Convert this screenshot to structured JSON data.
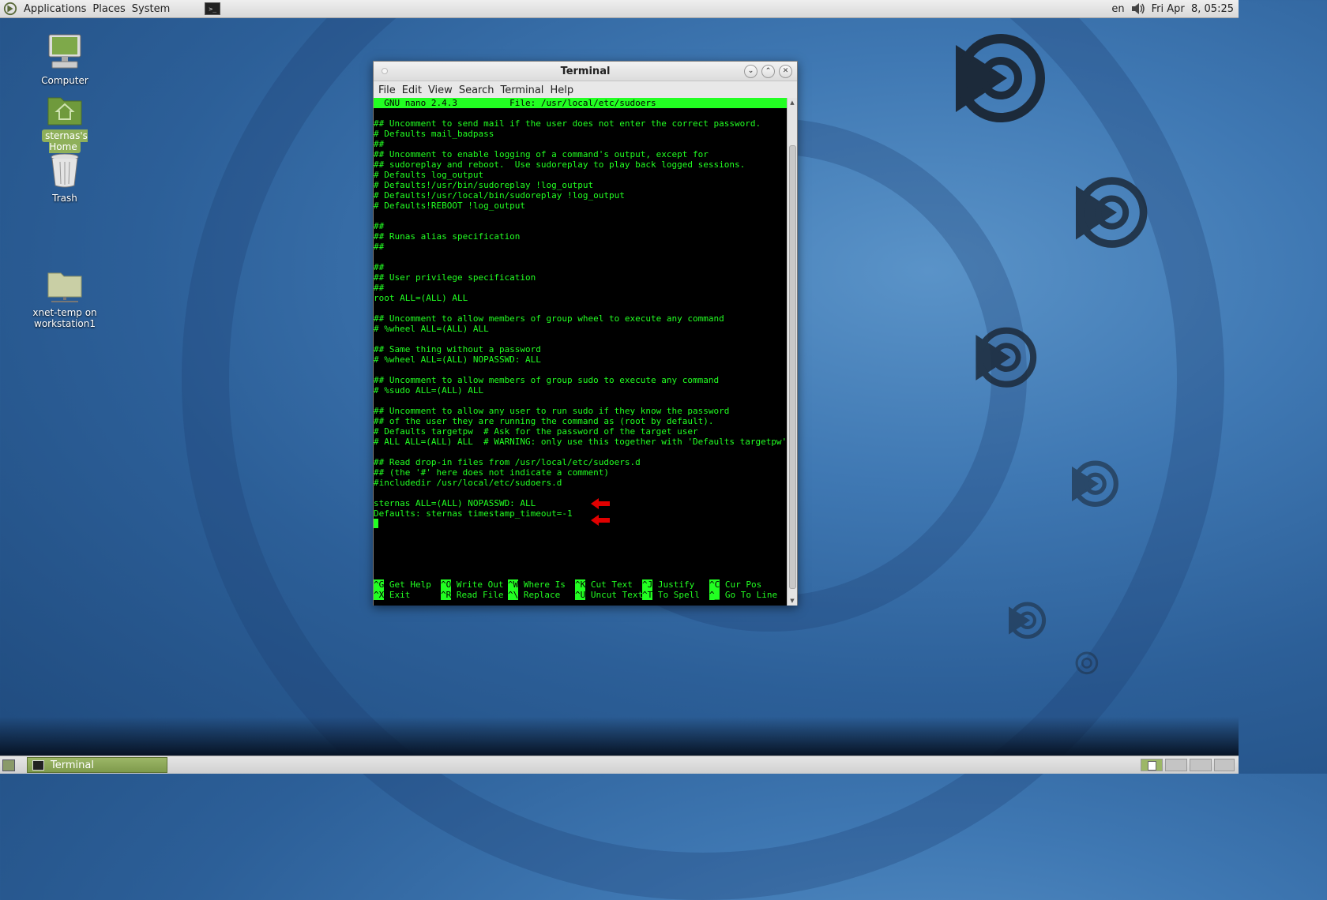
{
  "top_panel": {
    "menus": [
      "Applications",
      "Places",
      "System"
    ],
    "keyboard_layout": "en",
    "clock": "Fri Apr  8, 05:25"
  },
  "desktop_icons": [
    {
      "label": "Computer",
      "icon": "computer-icon"
    },
    {
      "label": "sternas's Home",
      "icon": "home-folder-icon",
      "selected": true
    },
    {
      "label": "Trash",
      "icon": "trash-icon"
    },
    {
      "label": "xnet-temp on\nworkstation1",
      "icon": "network-folder-icon"
    }
  ],
  "window": {
    "title": "Terminal",
    "menus": [
      "File",
      "Edit",
      "View",
      "Search",
      "Terminal",
      "Help"
    ]
  },
  "nano": {
    "header": "  GNU nano 2.4.3          File: /usr/local/etc/sudoers",
    "lines": [
      "",
      "## Uncomment to send mail if the user does not enter the correct password.",
      "# Defaults mail_badpass",
      "##",
      "## Uncomment to enable logging of a command's output, except for",
      "## sudoreplay and reboot.  Use sudoreplay to play back logged sessions.",
      "# Defaults log_output",
      "# Defaults!/usr/bin/sudoreplay !log_output",
      "# Defaults!/usr/local/bin/sudoreplay !log_output",
      "# Defaults!REBOOT !log_output",
      "",
      "##",
      "## Runas alias specification",
      "##",
      "",
      "##",
      "## User privilege specification",
      "##",
      "root ALL=(ALL) ALL",
      "",
      "## Uncomment to allow members of group wheel to execute any command",
      "# %wheel ALL=(ALL) ALL",
      "",
      "## Same thing without a password",
      "# %wheel ALL=(ALL) NOPASSWD: ALL",
      "",
      "## Uncomment to allow members of group sudo to execute any command",
      "# %sudo ALL=(ALL) ALL",
      "",
      "## Uncomment to allow any user to run sudo if they know the password",
      "## of the user they are running the command as (root by default).",
      "# Defaults targetpw  # Ask for the password of the target user",
      "# ALL ALL=(ALL) ALL  # WARNING: only use this together with 'Defaults targetpw'",
      "",
      "## Read drop-in files from /usr/local/etc/sudoers.d",
      "## (the '#' here does not indicate a comment)",
      "#includedir /usr/local/etc/sudoers.d",
      "",
      "sternas ALL=(ALL) NOPASSWD: ALL",
      "Defaults: sternas timestamp_timeout=-1"
    ],
    "shortcuts_row1": [
      {
        "key": "^G",
        "label": "Get Help"
      },
      {
        "key": "^O",
        "label": "Write Out"
      },
      {
        "key": "^W",
        "label": "Where Is"
      },
      {
        "key": "^K",
        "label": "Cut Text"
      },
      {
        "key": "^J",
        "label": "Justify"
      },
      {
        "key": "^C",
        "label": "Cur Pos"
      }
    ],
    "shortcuts_row2": [
      {
        "key": "^X",
        "label": "Exit"
      },
      {
        "key": "^R",
        "label": "Read File"
      },
      {
        "key": "^\\",
        "label": "Replace"
      },
      {
        "key": "^U",
        "label": "Uncut Text"
      },
      {
        "key": "^T",
        "label": "To Spell"
      },
      {
        "key": "^_",
        "label": "Go To Line"
      }
    ]
  },
  "bottom_panel": {
    "task_label": "Terminal"
  },
  "colors": {
    "terminal_fg": "#22ff22",
    "terminal_bg": "#000000",
    "annotation_arrow": "#e00000"
  }
}
